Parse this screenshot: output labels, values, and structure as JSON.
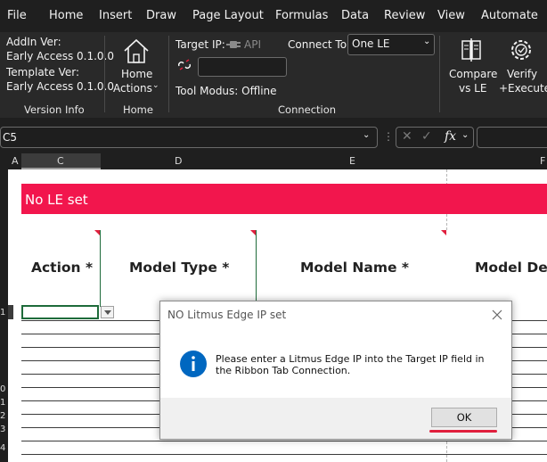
{
  "menu": [
    "File",
    "Home",
    "Insert",
    "Draw",
    "Page Layout",
    "Formulas",
    "Data",
    "Review",
    "View",
    "Automate"
  ],
  "ribbon": {
    "version_info": {
      "addin_label": "AddIn Ver:",
      "addin_value": "Early Access 0.1.0.0",
      "template_label": "Template Ver:",
      "template_value": "Early Access 0.1.0.0",
      "group_label": "Version Info"
    },
    "home": {
      "button_line1": "Home",
      "button_line2": "Actions",
      "group_label": "Home"
    },
    "connection": {
      "target_ip_label": "Target IP:",
      "api_label": "API",
      "connect_to_label": "Connect To:",
      "connect_to_value": "One LE",
      "tool_modus": "Tool Modus: Offline",
      "group_label": "Connection"
    },
    "compare": {
      "line1": "Compare",
      "line2": "vs LE"
    },
    "verify": {
      "line1": "Verify",
      "line2": "+Execute"
    }
  },
  "formula_bar": {
    "name_box": "C5",
    "fx": "fx"
  },
  "columns": [
    "A",
    "C",
    "D",
    "E",
    "F"
  ],
  "sheet": {
    "banner": "No LE set",
    "headers": [
      "Action *",
      "Model Type *",
      "Model Name *",
      "Model Des"
    ]
  },
  "row_numbers": [
    "1",
    "",
    "",
    "",
    "",
    "",
    "",
    "",
    "0",
    "1",
    "2",
    "3",
    "4"
  ],
  "dialog": {
    "title": "NO Litmus Edge IP set",
    "message": "Please enter a Litmus Edge IP into the Target IP field in the Ribbon Tab Connection.",
    "ok_label": "OK"
  },
  "colors": {
    "banner": "#f2164d",
    "accent_underline": "#e01f3d",
    "info_icon": "#0067c0"
  }
}
